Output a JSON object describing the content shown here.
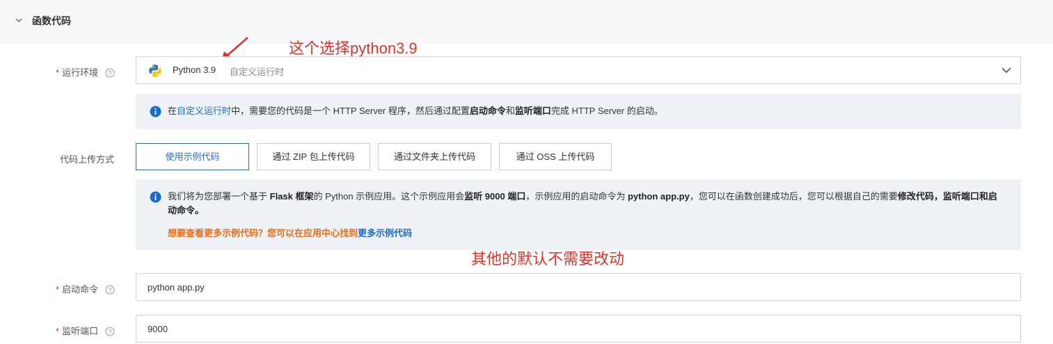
{
  "section": {
    "title": "函数代码"
  },
  "annotations": {
    "runtime_note": "这个选择python3.9",
    "default_note": "其他的默认不需要改动"
  },
  "runtime": {
    "label": "运行环境",
    "value": "Python 3.9",
    "tag": "自定义运行时",
    "info": {
      "prefix": "在",
      "link": "自定义运行时",
      "middle": "中，需要您的代码是一个 HTTP Server 程序，然后通过配置",
      "bold1": "启动命令",
      "and": "和",
      "bold2": "监听端口",
      "suffix": "完成 HTTP Server 的启动。"
    }
  },
  "upload": {
    "label": "代码上传方式",
    "options": [
      "使用示例代码",
      "通过 ZIP 包上传代码",
      "通过文件夹上传代码",
      "通过 OSS 上传代码"
    ],
    "selected_index": 0,
    "info": {
      "t1": "我们将为您部署一个基于 ",
      "b1": "Flask 框架",
      "t2": "的 Python 示例应用。这个示例应用会",
      "b2": "监听 9000 端口",
      "t3": "，示例应用的启动命令为 ",
      "b3": "python app.py",
      "t4": "，您可以在函数创建成功后，您可以根据自己的需要",
      "b4": "修改代码，监听端口和启动命令。",
      "more_text": "想要查看更多示例代码？您可以在应用中心找到",
      "more_link": "更多示例代码"
    }
  },
  "start_command": {
    "label": "启动命令",
    "value": "python app.py"
  },
  "listen_port": {
    "label": "监听端口",
    "value": "9000"
  },
  "colors": {
    "accent": "#2a6ad1",
    "annotation": "#e0312a",
    "required": "#e0312a",
    "link": "#1a6bc8",
    "orange": "#ee6b14"
  }
}
